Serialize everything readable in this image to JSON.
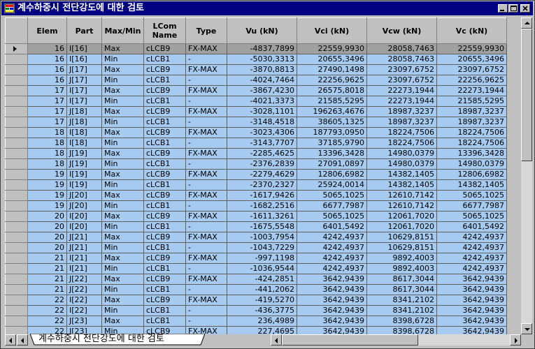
{
  "window": {
    "title": "계수하중시 전단강도에 대한 검토",
    "icon": "app-grid-icon",
    "colors": {
      "titlebar": "#000080",
      "row_bg": "#a6caf0",
      "current_row_bg": "#a0a0a0",
      "chrome": "#c0c0c0"
    }
  },
  "table": {
    "headers": [
      {
        "label": "Elem"
      },
      {
        "label": "Part"
      },
      {
        "label": "Max/Min"
      },
      {
        "label": "LCom Name"
      },
      {
        "label": "Type"
      },
      {
        "label": "Vu (kN)"
      },
      {
        "label": "Vci (kN)"
      },
      {
        "label": "Vcw (kN)"
      },
      {
        "label": "Vc (kN)"
      }
    ],
    "rows": [
      {
        "elem": "16",
        "part": "I[16]",
        "maxmin": "Max",
        "lcom": "cLCB9",
        "type": "FX-MAX",
        "vu": "-4837,7899",
        "vci": "22559,9930",
        "vcw": "28058,7463",
        "vc": "22559,9930"
      },
      {
        "elem": "16",
        "part": "I[16]",
        "maxmin": "Min",
        "lcom": "cLCB1",
        "type": "-",
        "vu": "-5030,3313",
        "vci": "20655,3496",
        "vcw": "28058,7463",
        "vc": "20655,3496"
      },
      {
        "elem": "16",
        "part": "J[17]",
        "maxmin": "Max",
        "lcom": "cLCB9",
        "type": "FX-MAX",
        "vu": "-3870,8813",
        "vci": "27490,1498",
        "vcw": "23097,6752",
        "vc": "23097,6752"
      },
      {
        "elem": "16",
        "part": "J[17]",
        "maxmin": "Min",
        "lcom": "cLCB1",
        "type": "-",
        "vu": "-4024,7464",
        "vci": "22256,9625",
        "vcw": "23097,6752",
        "vc": "22256,9625"
      },
      {
        "elem": "17",
        "part": "I[17]",
        "maxmin": "Max",
        "lcom": "cLCB9",
        "type": "FX-MAX",
        "vu": "-3867,4230",
        "vci": "26575,8018",
        "vcw": "22273,1944",
        "vc": "22273,1944"
      },
      {
        "elem": "17",
        "part": "I[17]",
        "maxmin": "Min",
        "lcom": "cLCB1",
        "type": "-",
        "vu": "-4021,3373",
        "vci": "21585,5295",
        "vcw": "22273,1944",
        "vc": "21585,5295"
      },
      {
        "elem": "17",
        "part": "J[18]",
        "maxmin": "Max",
        "lcom": "cLCB9",
        "type": "FX-MAX",
        "vu": "-3028,1101",
        "vci": "196263,4676",
        "vcw": "18987,3237",
        "vc": "18987,3237"
      },
      {
        "elem": "17",
        "part": "J[18]",
        "maxmin": "Min",
        "lcom": "cLCB1",
        "type": "-",
        "vu": "-3148,4518",
        "vci": "38605,1325",
        "vcw": "18987,3237",
        "vc": "18987,3237"
      },
      {
        "elem": "18",
        "part": "I[18]",
        "maxmin": "Max",
        "lcom": "cLCB9",
        "type": "FX-MAX",
        "vu": "-3023,4306",
        "vci": "187793,0950",
        "vcw": "18224,7506",
        "vc": "18224,7506"
      },
      {
        "elem": "18",
        "part": "I[18]",
        "maxmin": "Min",
        "lcom": "cLCB1",
        "type": "-",
        "vu": "-3143,7707",
        "vci": "37185,9790",
        "vcw": "18224,7506",
        "vc": "18224,7506"
      },
      {
        "elem": "18",
        "part": "J[19]",
        "maxmin": "Max",
        "lcom": "cLCB9",
        "type": "FX-MAX",
        "vu": "-2285,4625",
        "vci": "13396,3428",
        "vcw": "14980,0379",
        "vc": "13396,3428"
      },
      {
        "elem": "18",
        "part": "J[19]",
        "maxmin": "Min",
        "lcom": "cLCB1",
        "type": "-",
        "vu": "-2376,2839",
        "vci": "27091,0897",
        "vcw": "14980,0379",
        "vc": "14980,0379"
      },
      {
        "elem": "19",
        "part": "I[19]",
        "maxmin": "Max",
        "lcom": "cLCB9",
        "type": "FX-MAX",
        "vu": "-2279,4629",
        "vci": "12806,6982",
        "vcw": "14382,1405",
        "vc": "12806,6982"
      },
      {
        "elem": "19",
        "part": "I[19]",
        "maxmin": "Min",
        "lcom": "cLCB1",
        "type": "-",
        "vu": "-2370,2327",
        "vci": "25924,0014",
        "vcw": "14382,1405",
        "vc": "14382,1405"
      },
      {
        "elem": "19",
        "part": "J[20]",
        "maxmin": "Max",
        "lcom": "cLCB9",
        "type": "FX-MAX",
        "vu": "-1617,9426",
        "vci": "5065,1025",
        "vcw": "12610,7142",
        "vc": "5065,1025"
      },
      {
        "elem": "19",
        "part": "J[20]",
        "maxmin": "Min",
        "lcom": "cLCB1",
        "type": "-",
        "vu": "-1682,2516",
        "vci": "6677,7987",
        "vcw": "12610,7142",
        "vc": "6677,7987"
      },
      {
        "elem": "20",
        "part": "I[20]",
        "maxmin": "Max",
        "lcom": "cLCB9",
        "type": "FX-MAX",
        "vu": "-1611,3261",
        "vci": "5065,1025",
        "vcw": "12061,7020",
        "vc": "5065,1025"
      },
      {
        "elem": "20",
        "part": "I[20]",
        "maxmin": "Min",
        "lcom": "cLCB1",
        "type": "-",
        "vu": "-1675,5548",
        "vci": "6401,5492",
        "vcw": "12061,7020",
        "vc": "6401,5492"
      },
      {
        "elem": "20",
        "part": "J[21]",
        "maxmin": "Max",
        "lcom": "cLCB9",
        "type": "FX-MAX",
        "vu": "-1003,7954",
        "vci": "4242,4937",
        "vcw": "10629,8151",
        "vc": "4242,4937"
      },
      {
        "elem": "20",
        "part": "J[21]",
        "maxmin": "Min",
        "lcom": "cLCB1",
        "type": "-",
        "vu": "-1043,7229",
        "vci": "4242,4937",
        "vcw": "10629,8151",
        "vc": "4242,4937"
      },
      {
        "elem": "21",
        "part": "I[21]",
        "maxmin": "Max",
        "lcom": "cLCB9",
        "type": "FX-MAX",
        "vu": "-997,1198",
        "vci": "4242,4937",
        "vcw": "9892,4003",
        "vc": "4242,4937"
      },
      {
        "elem": "21",
        "part": "I[21]",
        "maxmin": "Min",
        "lcom": "cLCB1",
        "type": "-",
        "vu": "-1036,9544",
        "vci": "4242,4937",
        "vcw": "9892,4003",
        "vc": "4242,4937"
      },
      {
        "elem": "21",
        "part": "J[22]",
        "maxmin": "Max",
        "lcom": "cLCB9",
        "type": "FX-MAX",
        "vu": "-424,2851",
        "vci": "3642,9439",
        "vcw": "8617,3044",
        "vc": "3642,9439"
      },
      {
        "elem": "21",
        "part": "J[22]",
        "maxmin": "Min",
        "lcom": "cLCB1",
        "type": "-",
        "vu": "-441,2062",
        "vci": "3642,9439",
        "vcw": "8617,3044",
        "vc": "3642,9439"
      },
      {
        "elem": "22",
        "part": "I[22]",
        "maxmin": "Max",
        "lcom": "cLCB9",
        "type": "FX-MAX",
        "vu": "-419,5270",
        "vci": "3642,9439",
        "vcw": "8341,2102",
        "vc": "3642,9439"
      },
      {
        "elem": "22",
        "part": "I[22]",
        "maxmin": "Min",
        "lcom": "cLCB1",
        "type": "-",
        "vu": "-436,3775",
        "vci": "3642,9439",
        "vcw": "8341,2102",
        "vc": "3642,9439"
      },
      {
        "elem": "22",
        "part": "J[23]",
        "maxmin": "Max",
        "lcom": "cLCB1",
        "type": "-",
        "vu": "236,4989",
        "vci": "3642,9439",
        "vcw": "8398,6728",
        "vc": "3642,9439"
      },
      {
        "elem": "22",
        "part": "J[23]",
        "maxmin": "Min",
        "lcom": "cLCB9",
        "type": "FX-MAX",
        "vu": "227,4695",
        "vci": "3642,9439",
        "vcw": "8398,6728",
        "vc": "3642,9439"
      }
    ]
  },
  "sheet_tab": {
    "label": "계수하중시 전단강도에 대한 검토"
  }
}
